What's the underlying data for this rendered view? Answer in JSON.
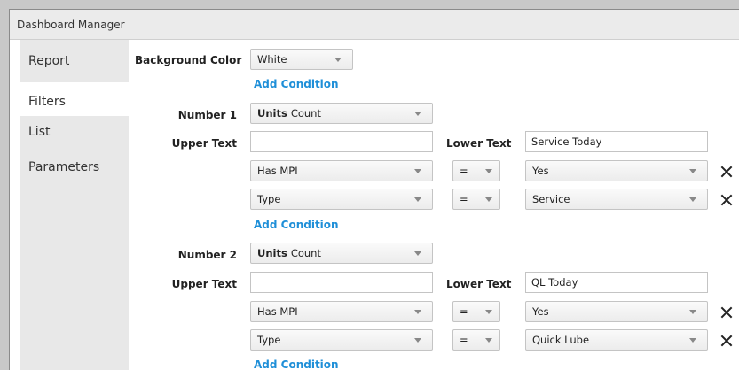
{
  "window": {
    "title": "Dashboard Manager"
  },
  "sidebar": {
    "items": [
      {
        "label": "Report"
      },
      {
        "label": "Filters"
      },
      {
        "label": "List"
      },
      {
        "label": "Parameters"
      }
    ]
  },
  "main": {
    "background_color": {
      "label": "Background Color",
      "value": "White"
    },
    "add_condition_label": "Add Condition",
    "units_label": "Units",
    "upper_text_label": "Upper Text",
    "lower_text_label": "Lower Text",
    "numbers": [
      {
        "label": "Number 1",
        "units_value": "Count",
        "upper_text": "",
        "lower_text": "Service Today",
        "conditions": [
          {
            "field": "Has MPI",
            "operator": "=",
            "value": "Yes"
          },
          {
            "field": "Type",
            "operator": "=",
            "value": "Service"
          }
        ]
      },
      {
        "label": "Number 2",
        "units_value": "Count",
        "upper_text": "",
        "lower_text": "QL Today",
        "conditions": [
          {
            "field": "Has MPI",
            "operator": "=",
            "value": "Yes"
          },
          {
            "field": "Type",
            "operator": "=",
            "value": "Quick Lube"
          }
        ]
      }
    ]
  },
  "icons": {
    "remove": "close-icon",
    "dropdown": "chevron-down-icon"
  },
  "colors": {
    "link": "#1f8fd8",
    "sidebar_bg": "#e8e8e8",
    "titlebar_bg": "#ebebeb"
  }
}
